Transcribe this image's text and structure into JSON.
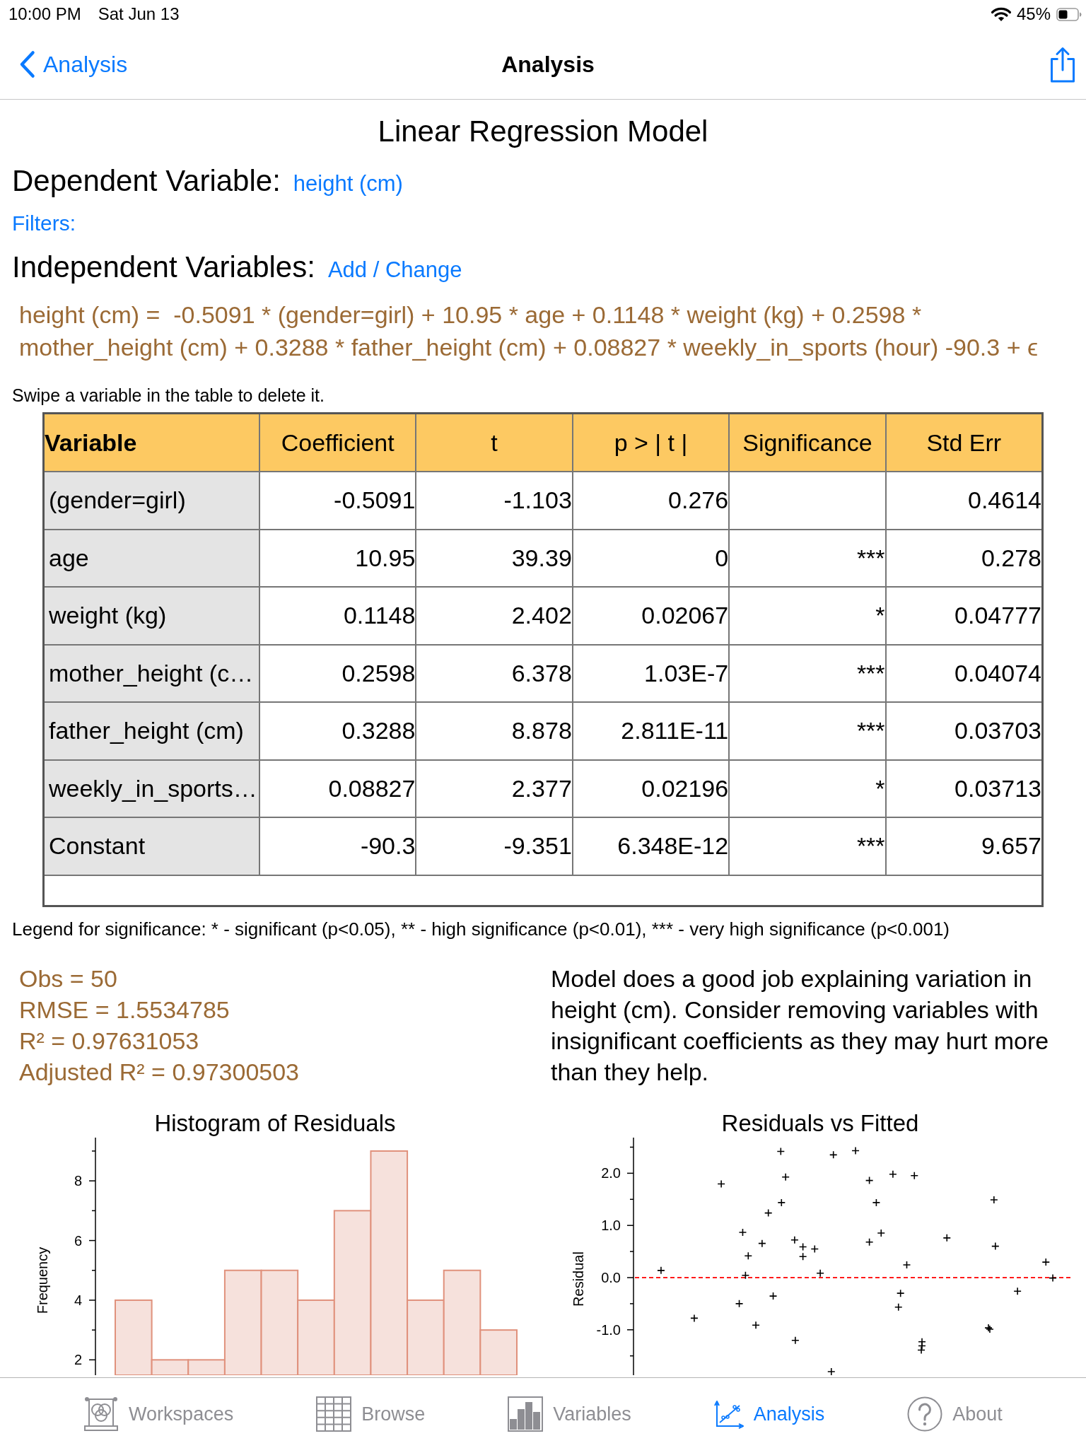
{
  "status_bar": {
    "time": "10:00 PM",
    "date": "Sat Jun 13",
    "battery_percent": "45%"
  },
  "nav_bar": {
    "back_label": "Analysis",
    "title": "Analysis"
  },
  "model": {
    "title": "Linear Regression Model",
    "dependent_label": "Dependent Variable:",
    "dependent_value": "height (cm)",
    "filters_link": "Filters:",
    "independent_label": "Independent Variables:",
    "independent_link": "Add / Change",
    "equation": "height (cm) =  -0.5091 * (gender=girl) + 10.95 * age + 0.1148 * weight (kg) + 0.2598 * mother_height (cm) + 0.3288 * father_height (cm) + 0.08827 * weekly_in_sports (hour) -90.3 + ϵ",
    "hint": "Swipe a variable in the table to delete it."
  },
  "table": {
    "columns": [
      "Variable",
      "Coefficient",
      "t",
      "p > | t |",
      "Significance",
      "Std Err"
    ],
    "rows": [
      {
        "variable": "(gender=girl)",
        "coefficient": "-0.5091",
        "t": "-1.103",
        "p": "0.276",
        "std_err": "0.4614"
      },
      {
        "variable": "age",
        "coefficient": "10.95",
        "t": "39.39",
        "p": "0",
        "significance": "***",
        "std_err": "0.278"
      },
      {
        "variable": "weight (kg)",
        "coefficient": "0.1148",
        "t": "2.402",
        "p": "0.02067",
        "significance": "*",
        "std_err": "0.04777"
      },
      {
        "variable": "mother_height (c…",
        "coefficient": "0.2598",
        "t": "6.378",
        "p": "1.03E-7",
        "significance": "***",
        "std_err": "0.04074"
      },
      {
        "variable": "father_height (cm)",
        "coefficient": "0.3288",
        "t": "8.878",
        "p": "2.811E-11",
        "significance": "***",
        "std_err": "0.03703"
      },
      {
        "variable": "weekly_in_sports…",
        "coefficient": "0.08827",
        "t": "2.377",
        "p": "0.02196",
        "significance": "*",
        "std_err": "0.03713"
      },
      {
        "variable": "Constant",
        "coefficient": "-90.3",
        "t": "-9.351",
        "p": "6.348E-12",
        "significance": "***",
        "std_err": "9.657"
      }
    ]
  },
  "legend": "Legend for significance: * - significant (p<0.05), ** - high significance (p<0.01), *** - very high significance (p<0.001)",
  "statistics": [
    "Obs = 50",
    "RMSE = 1.5534785",
    "R² = 0.97631053",
    "Adjusted R² = 0.97300503"
  ],
  "assessment": "Model does a good job explaining variation in height (cm). Consider removing variables with insignificant coefficients as they may hurt more than they help.",
  "histogram": {
    "title": "Histogram of Residuals",
    "ylabel": "Frequency",
    "tick_labels": [
      "8",
      "6",
      "4",
      "2"
    ]
  },
  "residual_plot": {
    "title": "Residuals vs Fitted",
    "ylabel": "Residual",
    "tick_labels": [
      "2.0",
      "1.0",
      "0.0",
      "-1.0"
    ]
  },
  "tab_bar": [
    {
      "label": "Workspaces",
      "selected": false
    },
    {
      "label": "Browse",
      "selected": false
    },
    {
      "label": "Variables",
      "selected": false
    },
    {
      "label": "Analysis",
      "selected": true
    },
    {
      "label": "About",
      "selected": false
    }
  ]
}
